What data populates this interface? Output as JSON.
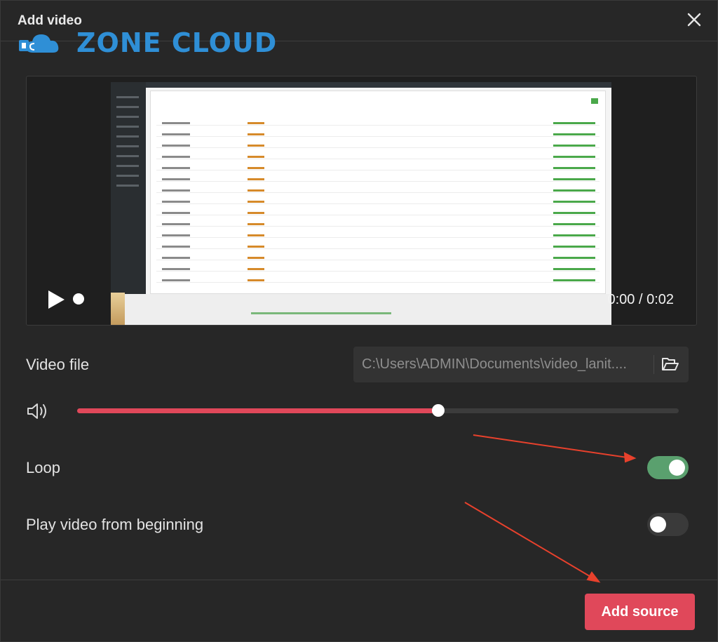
{
  "dialog": {
    "title": "Add video"
  },
  "watermark": {
    "text": "ZONE CLOUD"
  },
  "player": {
    "time": "0:00 / 0:02",
    "progress": 0
  },
  "video_file": {
    "label": "Video file",
    "path": "C:\\Users\\ADMIN\\Documents\\video_lanit...."
  },
  "volume": {
    "level": 0.6
  },
  "loop": {
    "label": "Loop",
    "enabled": true
  },
  "restart": {
    "label": "Play video from beginning",
    "enabled": false
  },
  "actions": {
    "add_source": "Add source"
  },
  "colors": {
    "accent": "#e0485a",
    "toggle_on": "#5aa06e",
    "background": "#272727",
    "annotation_arrow": "#e8412c"
  }
}
